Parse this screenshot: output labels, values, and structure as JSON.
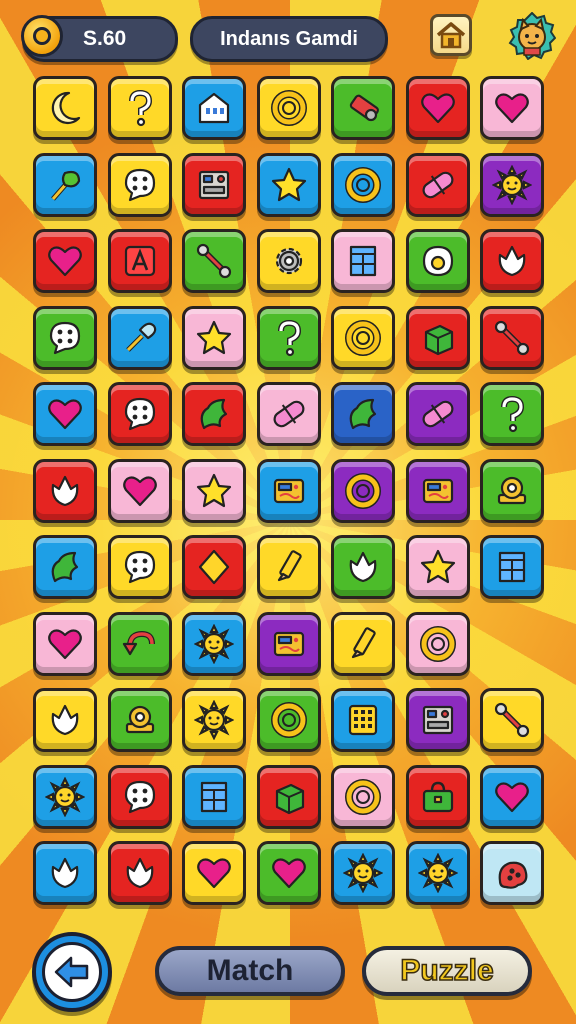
{
  "header": {
    "coins": "S.60",
    "title": "Indanıs Gamdi",
    "home_icon": "house-icon",
    "profile_icon": "cat-avatar-icon"
  },
  "board": {
    "rows": 11,
    "cols": 7,
    "tiles": [
      [
        {
          "color": "yellow",
          "icon": "crescent"
        },
        {
          "color": "yellow",
          "icon": "question"
        },
        {
          "color": "blue",
          "icon": "house"
        },
        {
          "color": "yellow",
          "icon": "ring"
        },
        {
          "color": "green",
          "icon": "roll"
        },
        {
          "color": "red",
          "icon": "heart"
        },
        {
          "color": "pink",
          "icon": "heart"
        }
      ],
      [
        {
          "color": "blue",
          "icon": "leaf-wand"
        },
        {
          "color": "yellow",
          "icon": "dice-bubble"
        },
        {
          "color": "red",
          "icon": "machine"
        },
        {
          "color": "blue",
          "icon": "star"
        },
        {
          "color": "blue",
          "icon": "ring"
        },
        {
          "color": "red",
          "icon": "pill"
        },
        {
          "color": "purple",
          "icon": "sun"
        }
      ],
      [
        {
          "color": "red",
          "icon": "heart"
        },
        {
          "color": "red",
          "icon": "letter-a"
        },
        {
          "color": "green",
          "icon": "wrench"
        },
        {
          "color": "yellow",
          "icon": "gear"
        },
        {
          "color": "pink",
          "icon": "window"
        },
        {
          "color": "green",
          "icon": "egg"
        },
        {
          "color": "red",
          "icon": "tulip"
        }
      ],
      [
        {
          "color": "green",
          "icon": "dice-bubble"
        },
        {
          "color": "blue",
          "icon": "brush"
        },
        {
          "color": "pink",
          "icon": "star"
        },
        {
          "color": "green",
          "icon": "question"
        },
        {
          "color": "yellow",
          "icon": "ring"
        },
        {
          "color": "red",
          "icon": "cube"
        },
        {
          "color": "red",
          "icon": "wrench"
        }
      ],
      [
        {
          "color": "blue",
          "icon": "heart"
        },
        {
          "color": "red",
          "icon": "dice-bubble"
        },
        {
          "color": "red",
          "icon": "leaf"
        },
        {
          "color": "pink",
          "icon": "pill"
        },
        {
          "color": "navy",
          "icon": "leaf"
        },
        {
          "color": "purple",
          "icon": "pill"
        },
        {
          "color": "green",
          "icon": "question"
        }
      ],
      [
        {
          "color": "red",
          "icon": "tulip"
        },
        {
          "color": "pink",
          "icon": "heart"
        },
        {
          "color": "pink",
          "icon": "star"
        },
        {
          "color": "blue",
          "icon": "panel"
        },
        {
          "color": "purple",
          "icon": "ring"
        },
        {
          "color": "purple",
          "icon": "panel"
        },
        {
          "color": "green",
          "icon": "tape"
        }
      ],
      [
        {
          "color": "blue",
          "icon": "leaf"
        },
        {
          "color": "yellow",
          "icon": "dice-bubble"
        },
        {
          "color": "red",
          "icon": "diamond"
        },
        {
          "color": "yellow",
          "icon": "pencil"
        },
        {
          "color": "green",
          "icon": "tulip"
        },
        {
          "color": "pink",
          "icon": "star"
        },
        {
          "color": "blue",
          "icon": "window"
        }
      ],
      [
        {
          "color": "pink",
          "icon": "heart"
        },
        {
          "color": "green",
          "icon": "arrow-turn"
        },
        {
          "color": "blue",
          "icon": "sun"
        },
        {
          "color": "purple",
          "icon": "panel"
        },
        {
          "color": "yellow",
          "icon": "pencil"
        },
        {
          "color": "pink",
          "icon": "ring"
        }
      ],
      [
        {
          "color": "yellow",
          "icon": "tulip"
        },
        {
          "color": "green",
          "icon": "tape"
        },
        {
          "color": "yellow",
          "icon": "sun"
        },
        {
          "color": "green",
          "icon": "ring"
        },
        {
          "color": "blue",
          "icon": "keypad"
        },
        {
          "color": "purple",
          "icon": "machine"
        },
        {
          "color": "yellow",
          "icon": "wrench"
        }
      ],
      [
        {
          "color": "blue",
          "icon": "sun"
        },
        {
          "color": "red",
          "icon": "dice-bubble"
        },
        {
          "color": "blue",
          "icon": "window"
        },
        {
          "color": "red",
          "icon": "cube"
        },
        {
          "color": "pink",
          "icon": "ring"
        },
        {
          "color": "red",
          "icon": "bag"
        },
        {
          "color": "blue",
          "icon": "heart"
        }
      ],
      [
        {
          "color": "blue",
          "icon": "tulip"
        },
        {
          "color": "red",
          "icon": "tulip"
        },
        {
          "color": "yellow",
          "icon": "heart"
        },
        {
          "color": "green",
          "icon": "heart"
        },
        {
          "color": "blue",
          "icon": "sun"
        },
        {
          "color": "blue",
          "icon": "sun"
        },
        {
          "color": "lightblue",
          "icon": "blob"
        }
      ]
    ]
  },
  "footer": {
    "back_icon": "back-arrow-icon",
    "match_label": "Match",
    "puzzle_label": "Puzzle"
  },
  "colors": {
    "yellow": "#ffd928",
    "blue": "#1e9fe6",
    "red": "#e52421",
    "green": "#4cbc2a",
    "pink": "#f8b7d6",
    "purple": "#8c2bc0",
    "lightblue": "#bfe7f4",
    "navy": "#2a63c7"
  }
}
